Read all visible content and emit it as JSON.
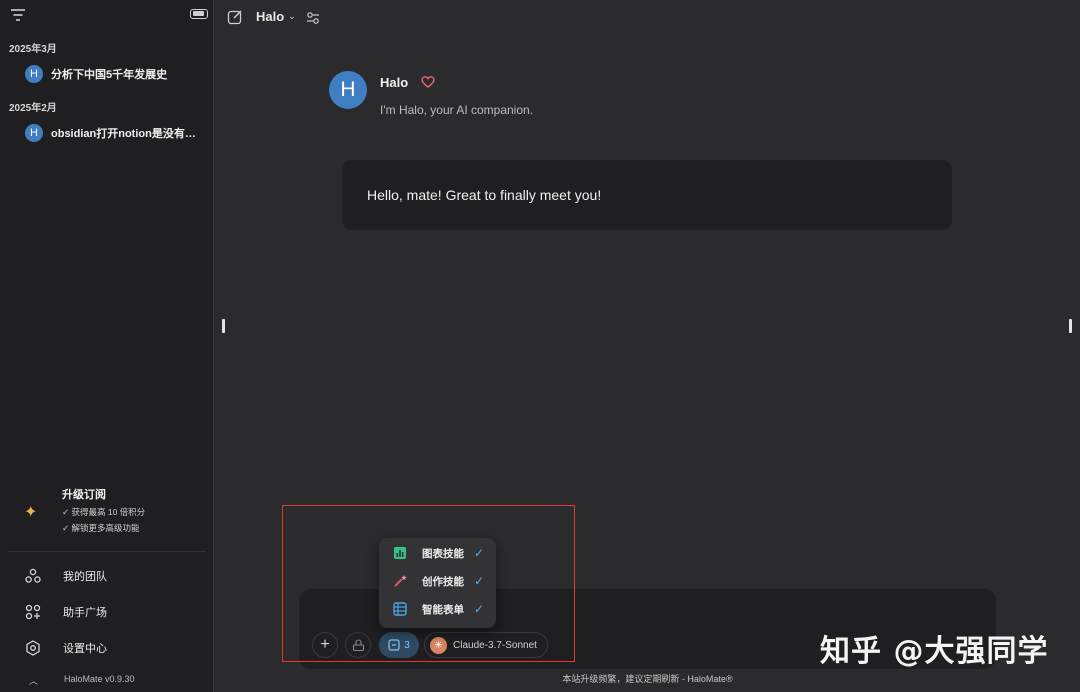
{
  "sidebar": {
    "groups": [
      {
        "date": "2025年3月",
        "items": [
          {
            "avatar": "H",
            "title": "分析下中国5千年发展史"
          }
        ]
      },
      {
        "date": "2025年2月",
        "items": [
          {
            "avatar": "H",
            "title": "obsidian打开notion是没有登录"
          }
        ]
      }
    ],
    "upgrade": {
      "title": "升级订阅",
      "lines": [
        "✓ 获得最高 10 倍积分",
        "✓ 解锁更多高级功能"
      ]
    },
    "nav": [
      {
        "label": "我的团队",
        "icon": "team-icon"
      },
      {
        "label": "助手广场",
        "icon": "apps-grid-icon"
      },
      {
        "label": "设置中心",
        "icon": "settings-hex-icon"
      }
    ],
    "version": "HaloMate v0.9.30"
  },
  "header": {
    "agent_name": "Halo"
  },
  "chat": {
    "bot_avatar": "H",
    "bot_name": "Halo",
    "bot_intro": "I'm Halo, your AI companion.",
    "greeting": "Hello, mate! Great to finally meet you!"
  },
  "composer": {
    "placeholder": "",
    "skills_count": "3",
    "model_name": "Claude-3.7-Sonnet"
  },
  "skills_popup": [
    {
      "label": "图表技能",
      "icon": "chart-icon",
      "color": "#3bbf8a",
      "checked": true
    },
    {
      "label": "创作技能",
      "icon": "magic-wand-icon",
      "color": "#e0566b",
      "checked": true
    },
    {
      "label": "智能表单",
      "icon": "form-table-icon",
      "color": "#4aa6e6",
      "checked": true
    }
  ],
  "footer_note": "本站升级频繁，建议定期刷新 - HaloMate®",
  "watermark": "知乎 @大强同学",
  "colors": {
    "sidebar_bg": "#1f1f21",
    "main_bg": "#2b2b2d",
    "accent": "#3f7ec3",
    "highlight": "#e03b30"
  }
}
